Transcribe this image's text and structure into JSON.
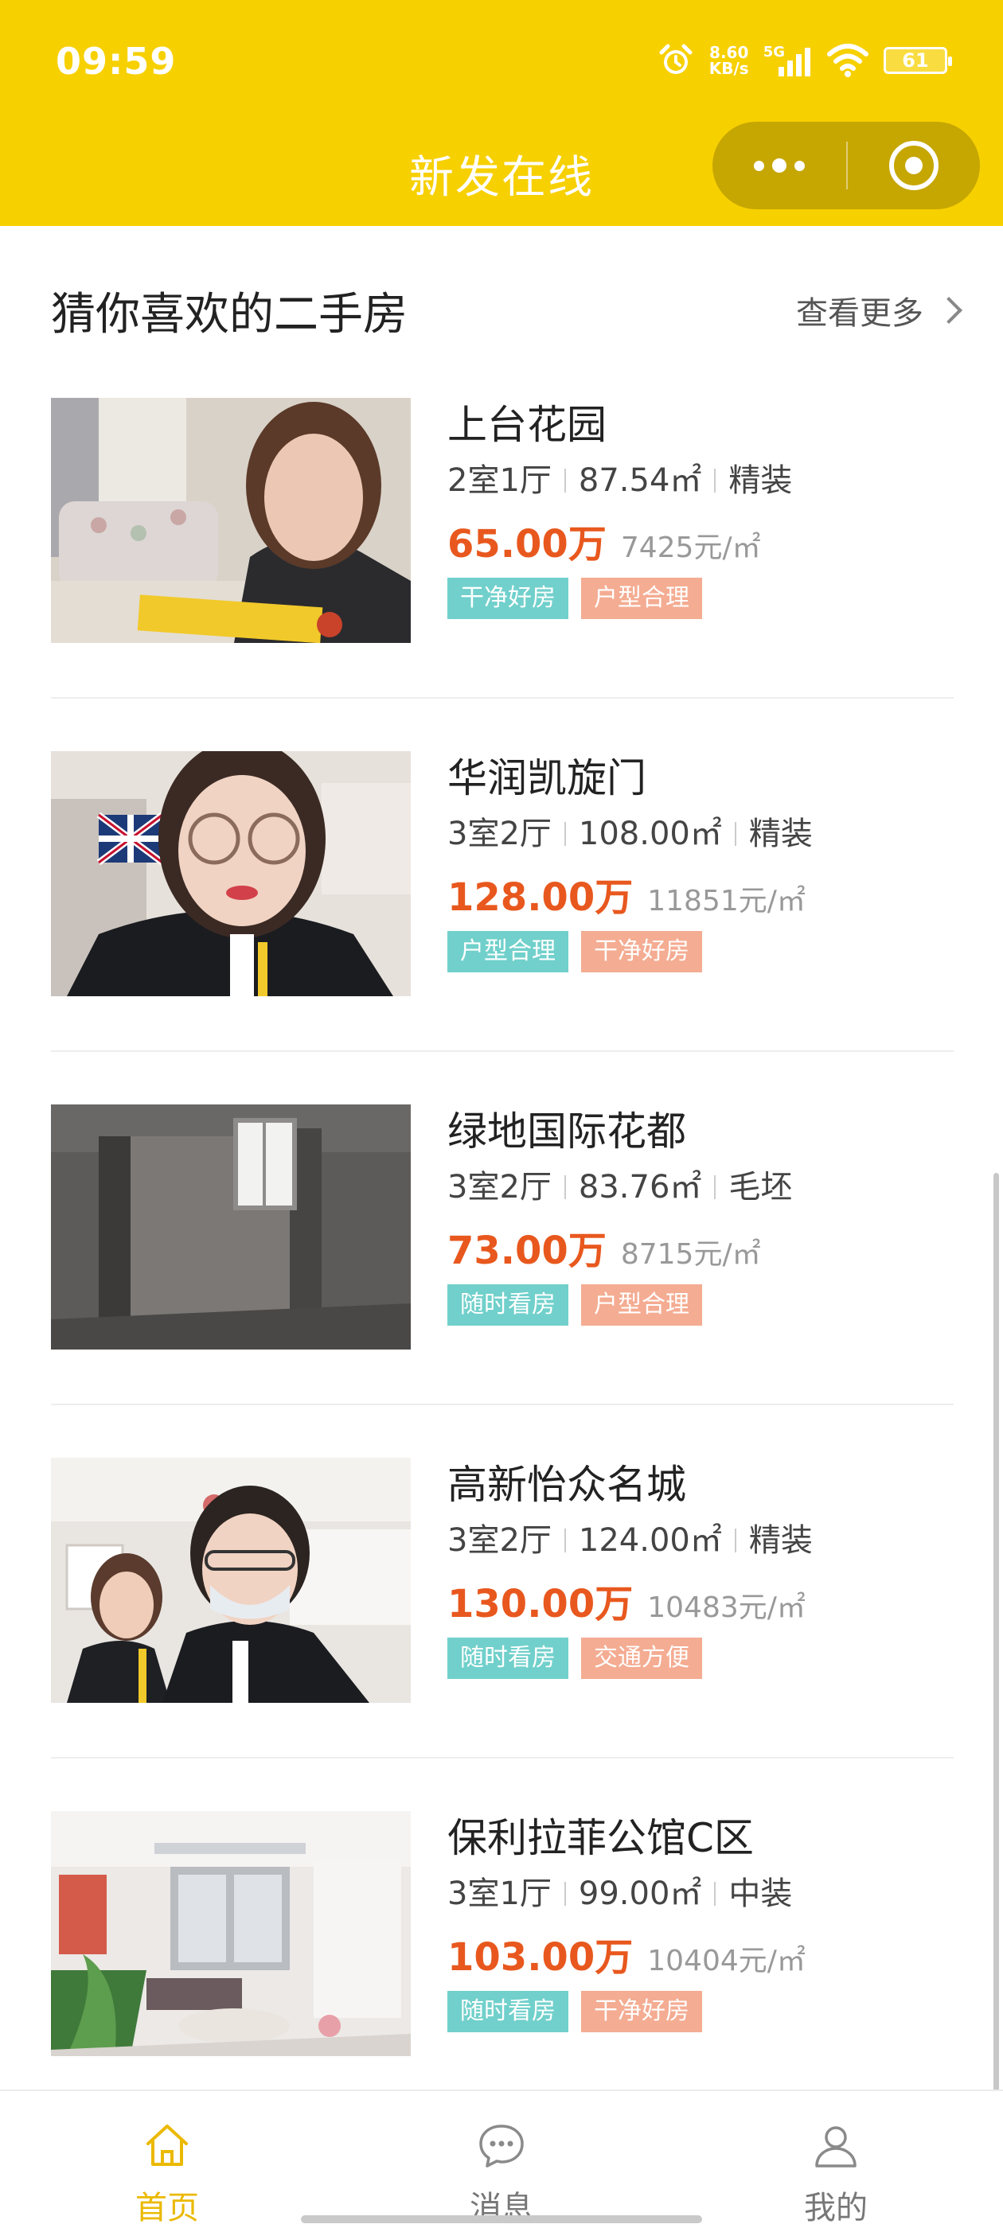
{
  "status_bar": {
    "time": "09:59",
    "net_speed_value": "8.60",
    "net_speed_unit": "KB/s",
    "network": "5G",
    "battery": "61"
  },
  "header": {
    "title": "新发在线",
    "capsule_more_icon": "more-dots-icon",
    "capsule_close_icon": "target-circle-icon",
    "background_color": "#F7D000"
  },
  "section": {
    "title": "猜你喜欢的二手房",
    "see_more_label": "查看更多"
  },
  "listings": [
    {
      "title": "上台花园",
      "layout": "2室1厅",
      "area": "87.54㎡",
      "decoration": "精装",
      "price": "65.00万",
      "unit_price": "7425元/㎡",
      "tags": [
        "干净好房",
        "户型合理"
      ]
    },
    {
      "title": "华润凯旋门",
      "layout": "3室2厅",
      "area": "108.00㎡",
      "decoration": "精装",
      "price": "128.00万",
      "unit_price": "11851元/㎡",
      "tags": [
        "户型合理",
        "干净好房"
      ]
    },
    {
      "title": "绿地国际花都",
      "layout": "3室2厅",
      "area": "83.76㎡",
      "decoration": "毛坯",
      "price": "73.00万",
      "unit_price": "8715元/㎡",
      "tags": [
        "随时看房",
        "户型合理"
      ]
    },
    {
      "title": "高新怡众名城",
      "layout": "3室2厅",
      "area": "124.00㎡",
      "decoration": "精装",
      "price": "130.00万",
      "unit_price": "10483元/㎡",
      "tags": [
        "随时看房",
        "交通方便"
      ]
    },
    {
      "title": "保利拉菲公馆C区",
      "layout": "3室1厅",
      "area": "99.00㎡",
      "decoration": "中装",
      "price": "103.00万",
      "unit_price": "10404元/㎡",
      "tags": [
        "随时看房",
        "干净好房"
      ]
    }
  ],
  "bottom_nav": [
    {
      "label": "首页",
      "icon": "home-icon",
      "active": true
    },
    {
      "label": "消息",
      "icon": "chat-icon",
      "active": false
    },
    {
      "label": "我的",
      "icon": "user-icon",
      "active": false
    }
  ],
  "colors": {
    "accent": "#F7D000",
    "price": "#E8581E",
    "tag_teal": "#71D0CB",
    "tag_salmon": "#F4AC92",
    "nav_active": "#EBB900"
  }
}
